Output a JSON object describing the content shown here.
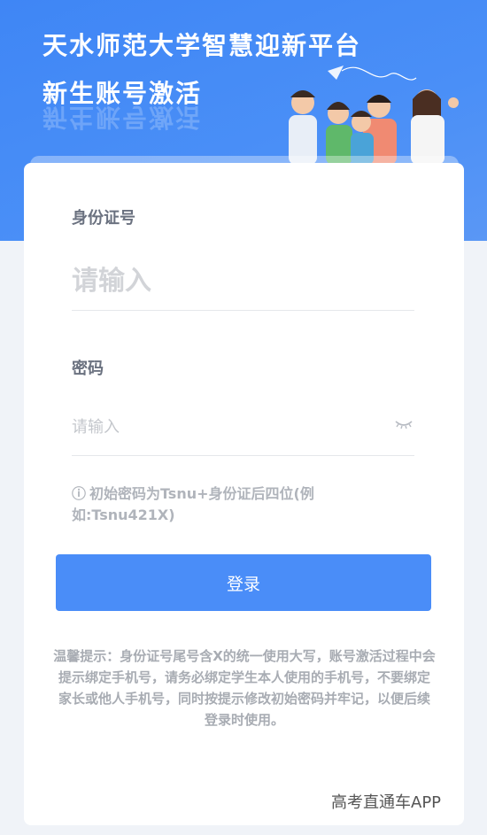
{
  "header": {
    "title_line1": "天水师范大学智慧迎新平台",
    "title_line2": "新生账号激活",
    "illustration_icon": "students-group-illustration"
  },
  "form": {
    "id_label": "身份证号",
    "id_placeholder": "请输入",
    "password_label": "密码",
    "password_placeholder": "请输入",
    "password_toggle_icon": "eye-closed-icon",
    "hint_icon": "ⓘ",
    "hint_text": "初始密码为Tsnu+身份证后四位(例如:Tsnu421X)"
  },
  "login_button": "登录",
  "notice": "温馨提示：身份证号尾号含X的统一使用大写，账号激活过程中会提示绑定手机号，请务必绑定学生本人使用的手机号，不要绑定家长或他人手机号，同时按提示修改初始密码并牢记，以便后续登录时使用。",
  "watermark": "高考直通车APP",
  "colors": {
    "primary": "#4a8df8",
    "header_bg": "#3f86f5",
    "page_bg": "#f0f3f8"
  }
}
